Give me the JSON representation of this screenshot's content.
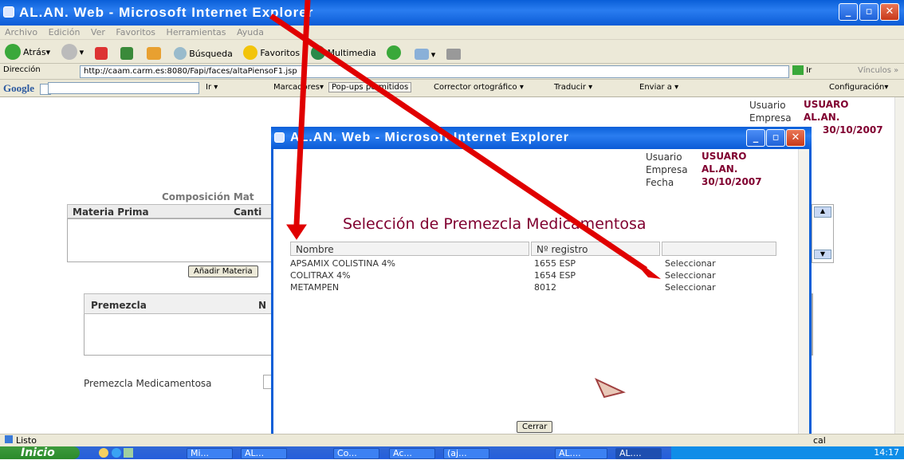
{
  "window": {
    "title": "AL.AN. Web - Microsoft Internet Explorer"
  },
  "menu": [
    "Archivo",
    "Edición",
    "Ver",
    "Favoritos",
    "Herramientas",
    "Ayuda"
  ],
  "toolbar": {
    "back": "Atrás",
    "search": "Búsqueda",
    "favorites": "Favoritos",
    "media": "Multimedia"
  },
  "address": {
    "label": "Dirección",
    "url": "http://caam.carm.es:8080/Fapi/faces/altaPiensoF1.jsp",
    "go": "Ir",
    "links": "Vínculos"
  },
  "google_bar": {
    "logo": "Google",
    "go": "Ir",
    "bookmarks": "Marcadores",
    "popups": "Pop-ups permitidos",
    "spell": "Corrector ortográfico",
    "translate": "Traducir",
    "send": "Enviar a",
    "settings": "Configuración"
  },
  "page": {
    "user_label": "Usuario",
    "user_value": "USUARO",
    "company_label": "Empresa",
    "company_value": "AL.AN.",
    "date_value": "30/10/2007",
    "composition_title": "Composición Mat",
    "col_materia": "Materia Prima",
    "col_cantidad": "Canti",
    "add_button": "Añadir Materia",
    "premezcla_header": "Premezcla",
    "premezcla_col2": "N",
    "premezcla_med_label": "Premezcla Medicamentosa"
  },
  "popup": {
    "title": "AL.AN. Web - Microsoft Internet Explorer",
    "user_label": "Usuario",
    "user_value": "USUARO",
    "company_label": "Empresa",
    "company_value": "AL.AN.",
    "date_label": "Fecha",
    "date_value": "30/10/2007",
    "heading": "Selección de Premezcla Medicamentosa",
    "col_name": "Nombre",
    "col_reg": "Nº registro",
    "rows": [
      {
        "name": "APSAMIX COLISTINA 4%",
        "reg": "1655 ESP",
        "action": "Seleccionar"
      },
      {
        "name": "COLITRAX 4%",
        "reg": "1654 ESP",
        "action": "Seleccionar"
      },
      {
        "name": "METAMPEN",
        "reg": "8012",
        "action": "Seleccionar"
      }
    ],
    "close_button": "Cerrar"
  },
  "status": {
    "text": "Listo",
    "right": "cal"
  },
  "taskbar": {
    "start": "Inicio",
    "tasks": [
      "Mi...",
      "AL...",
      "Co...",
      "Ac...",
      "(aj...",
      "AL....",
      "AL...."
    ],
    "clock": "14:17"
  },
  "colors": {
    "xp_blue": "#0a5fd8",
    "maroon": "#800030",
    "link": "#1a5fb4",
    "arrow": "#e00000"
  }
}
